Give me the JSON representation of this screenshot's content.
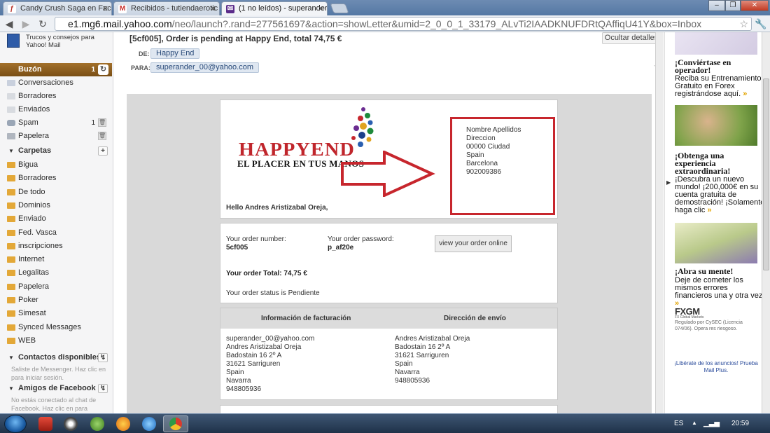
{
  "browser": {
    "tabs": [
      {
        "label": "Candy Crush Saga en Face",
        "icon": "facebook-icon",
        "active": false
      },
      {
        "label": "Recibidos - tutiendaerotic",
        "icon": "gmail-icon",
        "active": false
      },
      {
        "label": "(1 no leídos) - superander_",
        "icon": "yahoo-mail-icon",
        "active": true
      }
    ],
    "url_host": "e1.mg6.mail.yahoo.com",
    "url_rest": "/neo/launch?.rand=277561697&action=showLetter&umid=2_0_0_1_33179_ALvTi2IAADKNUFDRtQAffiqU41Y&box=Inbox"
  },
  "sidebar": {
    "promo_text": "Trucos y consejos para Yahoo! Mail",
    "inbox": {
      "label": "Buzón",
      "count": "1"
    },
    "system_folders": [
      {
        "label": "Conversaciones"
      },
      {
        "label": "Borradores"
      },
      {
        "label": "Enviados"
      },
      {
        "label": "Spam",
        "count": "1"
      },
      {
        "label": "Papelera"
      }
    ],
    "folders_header": "Carpetas",
    "folders": [
      "Bigua",
      "Borradores",
      "De todo",
      "Dominios",
      "Enviado",
      "Fed. Vasca",
      "inscripciones",
      "Internet",
      "Legalitas",
      "Papelera",
      "Poker",
      "Simesat",
      "Synced Messages",
      "WEB"
    ],
    "contacts_header": "Contactos disponibles",
    "contacts_note": "Saliste de Messenger. Haz clic en  para iniciar sesión.",
    "facebook_header": "Amigos de Facebook",
    "facebook_note": "No estás conectado al chat de Facebook. Haz clic en  para"
  },
  "message": {
    "subject": "[5cf005], Order is pending at Happy End, total 74,75 €",
    "hide_details": "Ocultar detalles",
    "from_label": "DE:",
    "from": "Happy End",
    "to_label": "PARA:",
    "to": "superander_00@yahoo.com"
  },
  "email": {
    "logo_text": "HAPPYEND",
    "slogan": "EL PLACER EN TUS MANOS",
    "address_box": [
      "Nombre Apellidos",
      "Direccion",
      "00000 Ciudad",
      "Spain",
      "Barcelona",
      "902009386"
    ],
    "greeting": "Hello Andres Aristizabal Oreja,",
    "order_number_label": "Your order number:",
    "order_number": "5cf005",
    "order_password_label": "Your order password:",
    "order_password": "p_af20e",
    "view_button": "view your order online",
    "order_total": "Your order Total: 74,75 €",
    "order_status": "Your order status is Pendiente",
    "billing_header": "Información de facturación",
    "shipping_header": "Dirección de envío",
    "billing": [
      "superander_00@yahoo.com",
      "Andres Aristizabal Oreja",
      "Badostain 16 2º A",
      "31621 Sarriguren",
      "Spain",
      "Navarra",
      "948805936"
    ],
    "shipping": [
      "Andres Aristizabal Oreja",
      "Badostain 16 2º A",
      "31621 Sarriguren",
      "Spain",
      "Navarra",
      "948805936"
    ]
  },
  "ads": {
    "ad1_title": "¡Conviértase en operador!",
    "ad1_text": "Reciba su Entrenamiento Gratuito en Forex registrándose aquí.",
    "ad2_title": "¡Obtenga una experiencia extraordinaria!",
    "ad2_text": "¡Descubra un nuevo mundo! ¡200,000€ en su cuenta gratuita de demostración! ¡Solamente haga clic",
    "ad3_title": "¡Abra su mente!",
    "ad3_text": "Deje de cometer los mismos errores financieros una y otra vez.",
    "brand": "FXGM",
    "brand_sub": "FX Global Markets",
    "regulation": "Regulado por CySEC (Licencia 074/06). Opera res riesgoso.",
    "free_of_ads": "¡Libérate de los anuncios! Prueba Mail Plus."
  },
  "taskbar": {
    "language": "ES",
    "time": "20:59"
  }
}
